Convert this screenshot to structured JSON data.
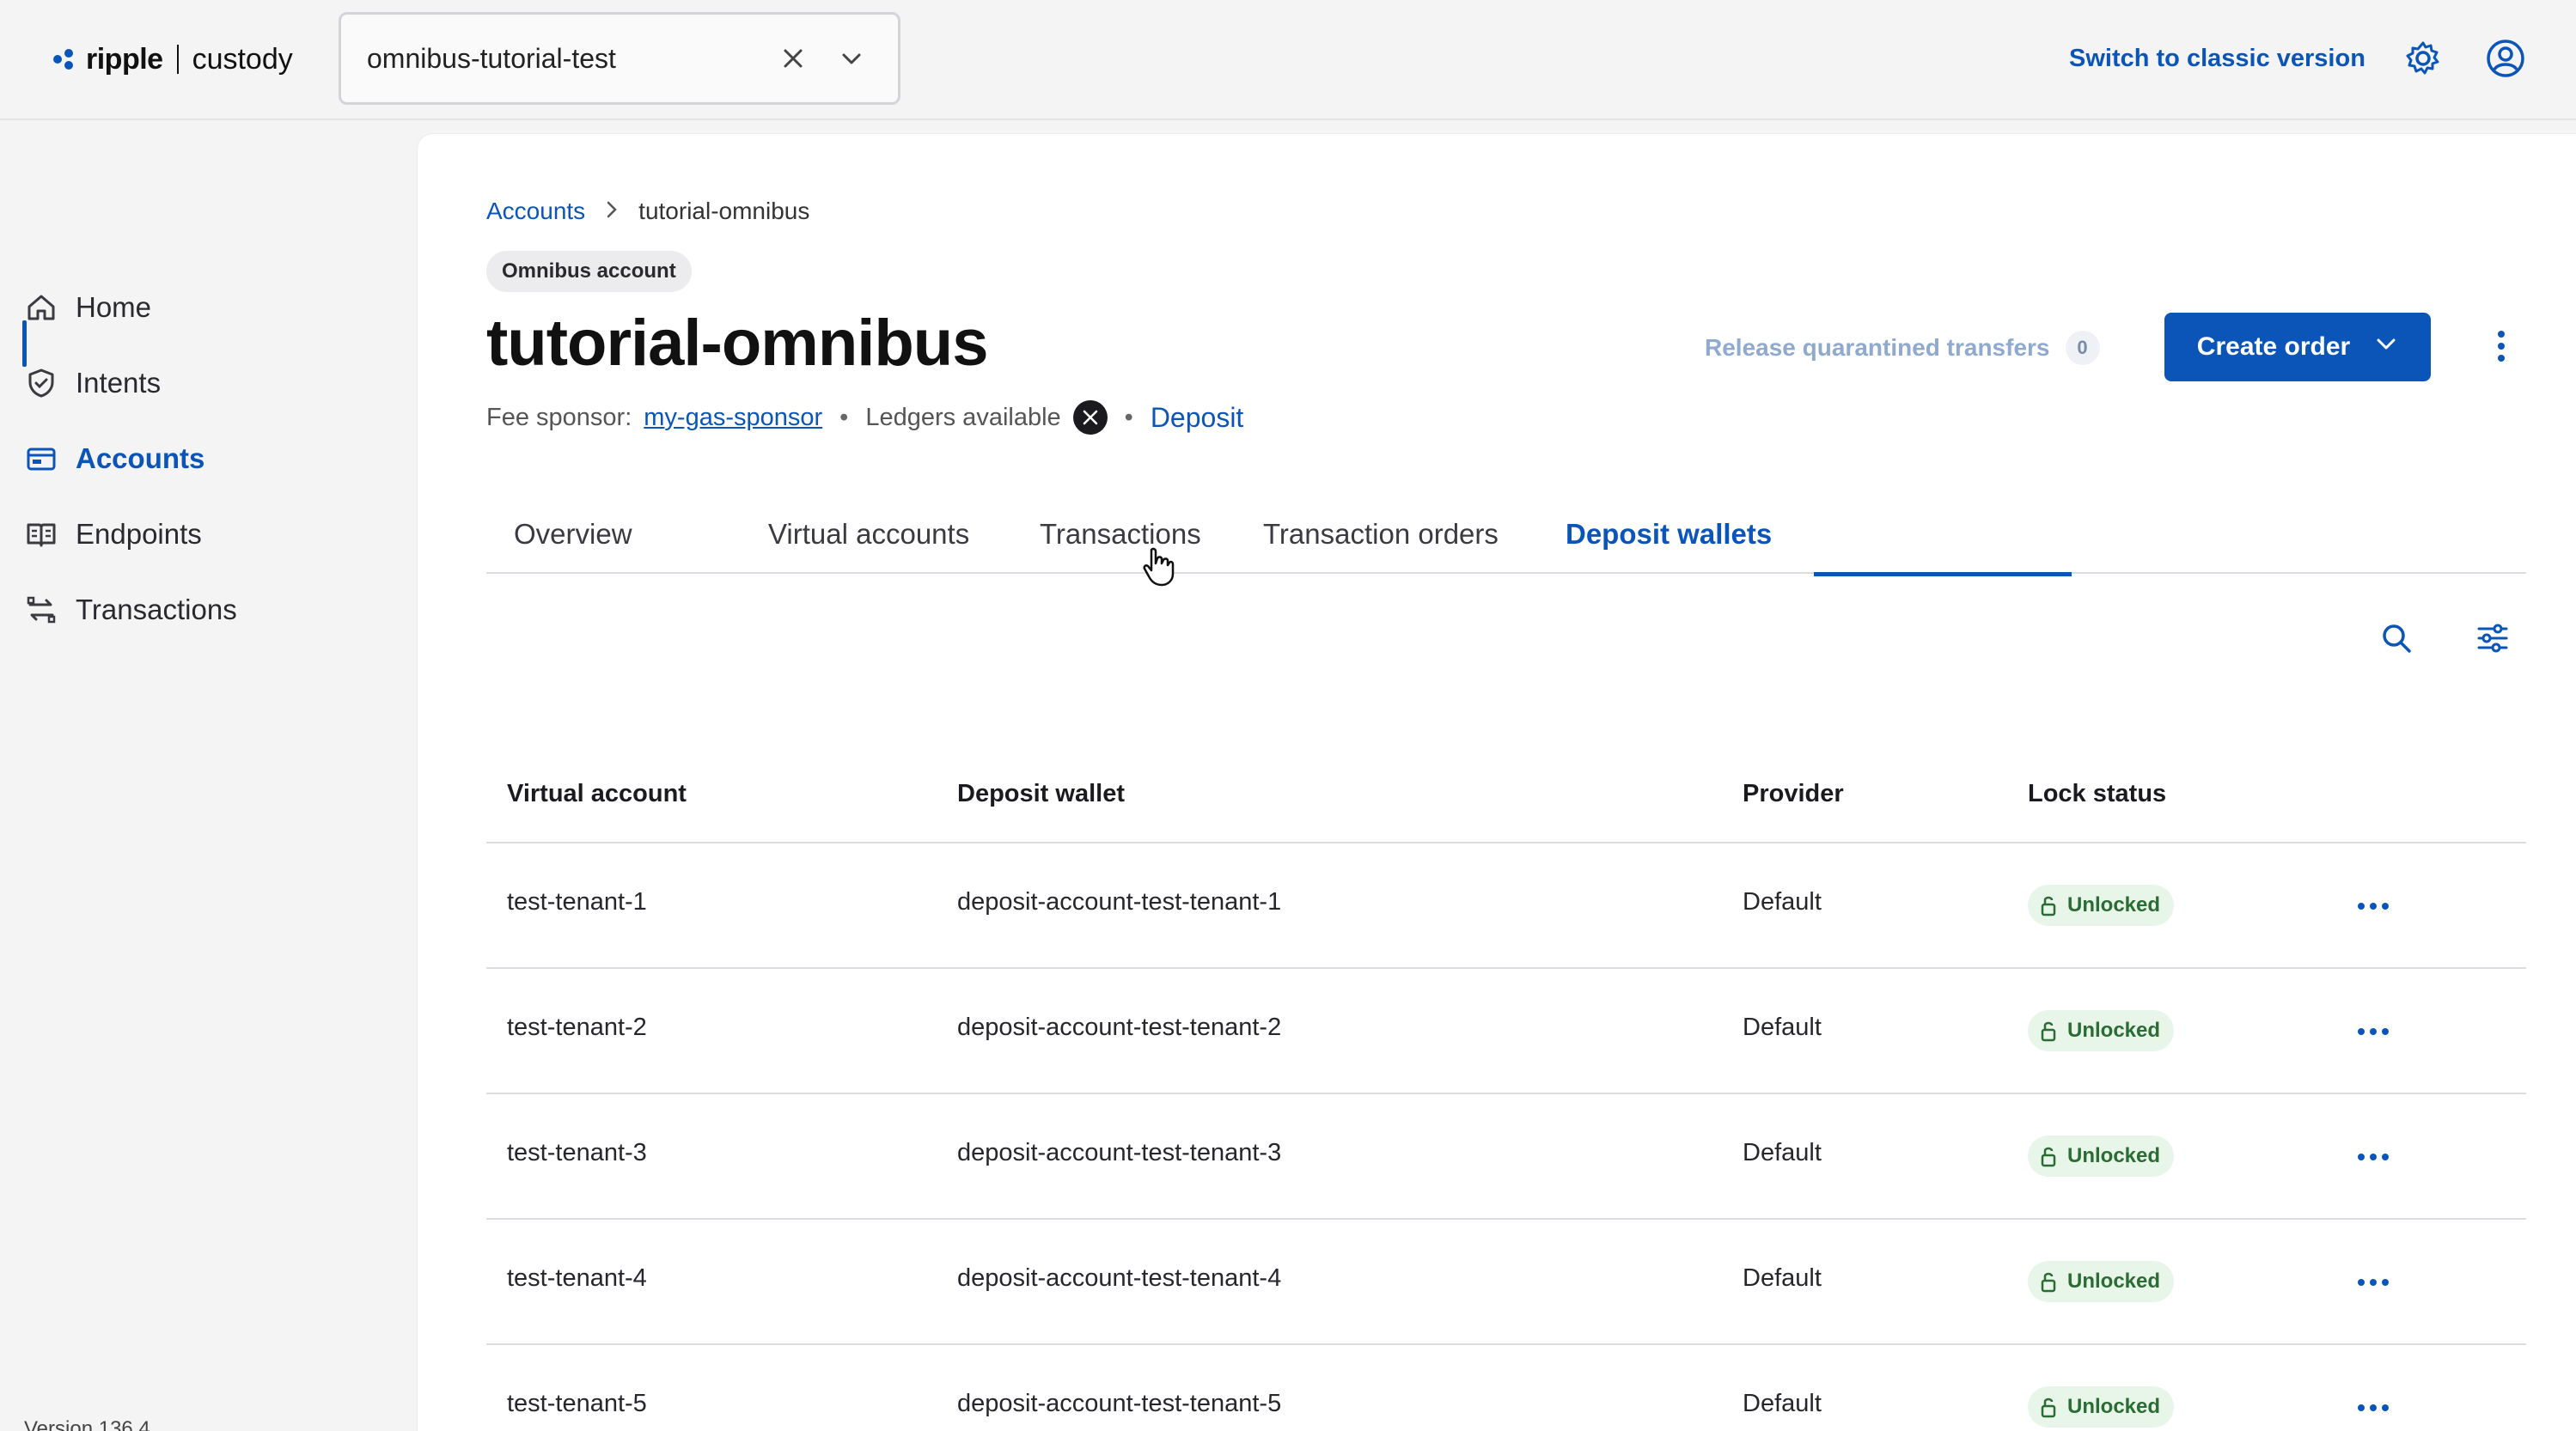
{
  "topbar": {
    "brand": "ripple",
    "product": "custody",
    "account_selector": {
      "value": "omnibus-tutorial-test"
    },
    "classic_link": "Switch to classic version"
  },
  "sidebar": {
    "items": [
      {
        "label": "Home",
        "icon": "home-icon"
      },
      {
        "label": "Intents",
        "icon": "shield-icon"
      },
      {
        "label": "Accounts",
        "icon": "wallet-icon",
        "active": true
      },
      {
        "label": "Endpoints",
        "icon": "book-icon"
      },
      {
        "label": "Transactions",
        "icon": "transfer-icon"
      }
    ],
    "version": "Version 136.4"
  },
  "main": {
    "breadcrumb": {
      "root": "Accounts",
      "current": "tutorial-omnibus"
    },
    "badge": "Omnibus account",
    "title": "tutorial-omnibus",
    "meta": {
      "fee_sponsor_label": "Fee sponsor:",
      "fee_sponsor_value": "my-gas-sponsor",
      "ledgers_label": "Ledgers available",
      "deposit_link": "Deposit"
    },
    "actions": {
      "release_label": "Release quarantined transfers",
      "release_count": "0",
      "create_order_label": "Create order"
    },
    "tabs": [
      {
        "label": "Overview"
      },
      {
        "label": "Virtual accounts"
      },
      {
        "label": "Transactions"
      },
      {
        "label": "Transaction orders"
      },
      {
        "label": "Deposit wallets",
        "active": true
      }
    ],
    "table": {
      "columns": [
        "Virtual account",
        "Deposit wallet",
        "Provider",
        "Lock status"
      ],
      "rows": [
        {
          "virtual_account": "test-tenant-1",
          "deposit_wallet": "deposit-account-test-tenant-1",
          "provider": "Default",
          "lock_status": "Unlocked"
        },
        {
          "virtual_account": "test-tenant-2",
          "deposit_wallet": "deposit-account-test-tenant-2",
          "provider": "Default",
          "lock_status": "Unlocked"
        },
        {
          "virtual_account": "test-tenant-3",
          "deposit_wallet": "deposit-account-test-tenant-3",
          "provider": "Default",
          "lock_status": "Unlocked"
        },
        {
          "virtual_account": "test-tenant-4",
          "deposit_wallet": "deposit-account-test-tenant-4",
          "provider": "Default",
          "lock_status": "Unlocked"
        },
        {
          "virtual_account": "test-tenant-5",
          "deposit_wallet": "deposit-account-test-tenant-5",
          "provider": "Default",
          "lock_status": "Unlocked"
        }
      ]
    }
  },
  "colors": {
    "accent": "#0b55b8",
    "success_bg": "#e8f6ea",
    "success_text": "#2b6b34"
  }
}
